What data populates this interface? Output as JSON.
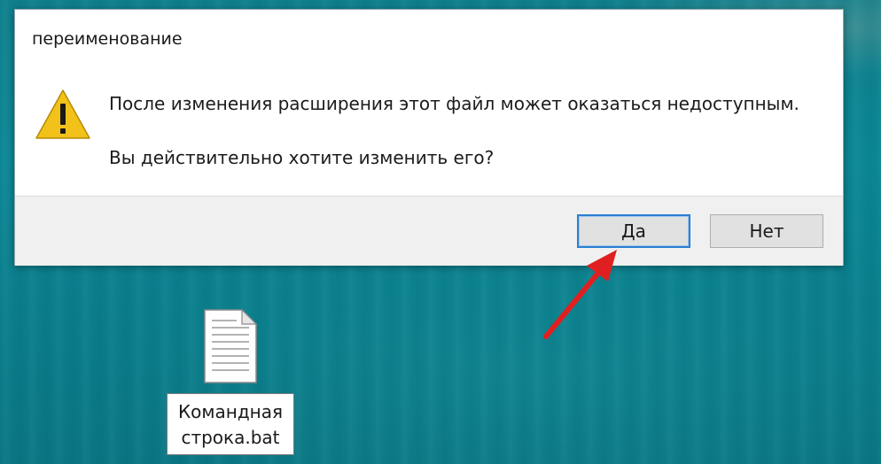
{
  "dialog": {
    "title": "переименование",
    "icon": "warning-icon",
    "message": "После изменения расширения этот файл может оказаться недоступным.",
    "question": "Вы действительно хотите изменить его?",
    "buttons": {
      "yes_label": "Да",
      "no_label": "Нет"
    }
  },
  "desktop": {
    "file": {
      "icon": "text-file-icon",
      "label_line1": "Командная",
      "label_line2": "строка.bat"
    },
    "annotation": {
      "icon": "red-arrow-icon",
      "color": "#e02020"
    }
  },
  "colors": {
    "accent_focus": "#2c7fd1",
    "warning_yellow": "#f2c21b",
    "desktop_teal": "#0c8795"
  }
}
